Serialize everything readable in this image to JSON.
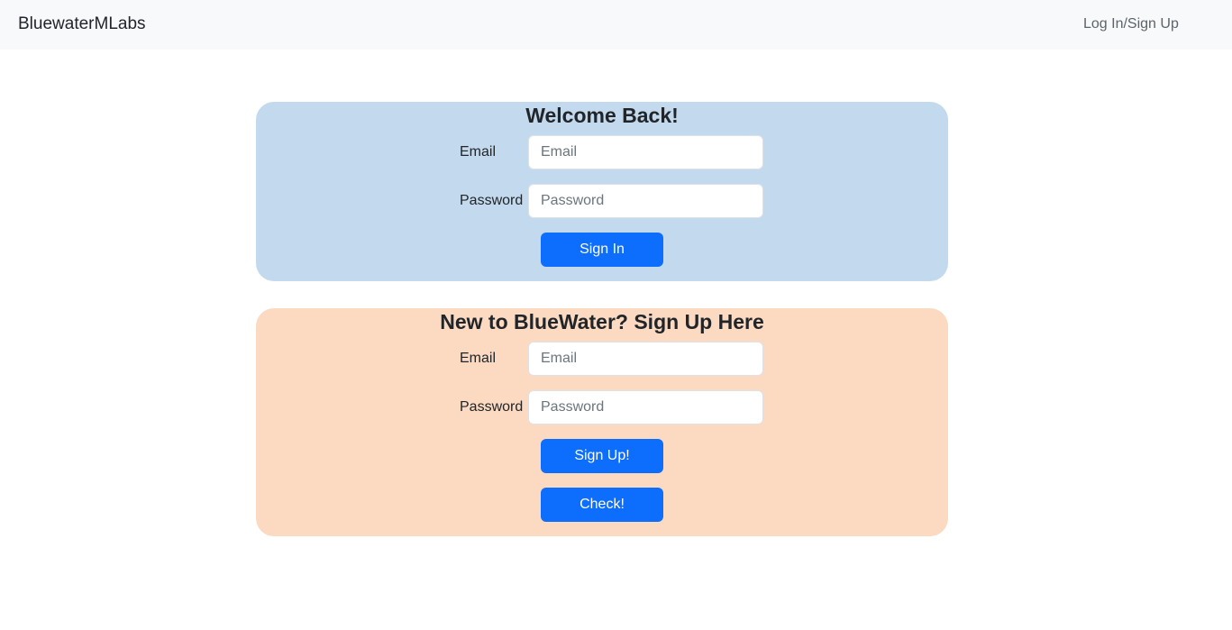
{
  "navbar": {
    "brand": "BluewaterMLabs",
    "login_link": "Log In/Sign Up"
  },
  "signin": {
    "title": "Welcome Back!",
    "email_label": "Email",
    "email_placeholder": "Email",
    "password_label": "Password",
    "password_placeholder": "Password",
    "button": "Sign In",
    "bg_color": "#c3daee"
  },
  "signup": {
    "title": "New to BlueWater? Sign Up Here",
    "email_label": "Email",
    "email_placeholder": "Email",
    "password_label": "Password",
    "password_placeholder": "Password",
    "button": "Sign Up!",
    "check_button": "Check!",
    "bg_color": "#fbdac1"
  }
}
